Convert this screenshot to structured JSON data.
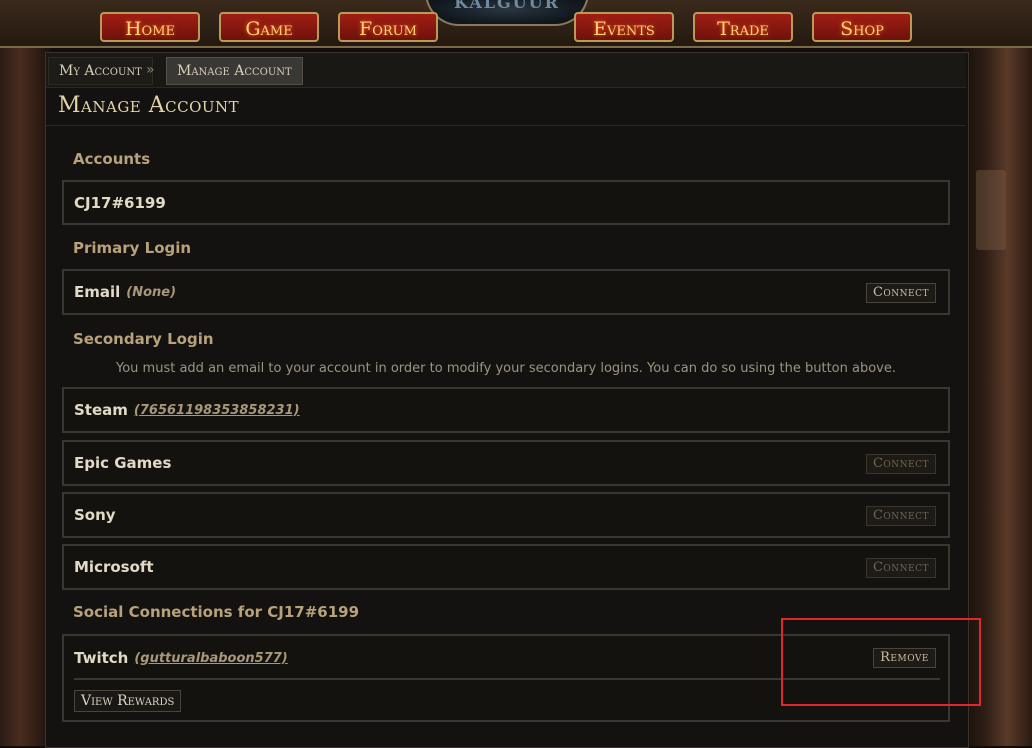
{
  "nav": {
    "logo": "KALGUUR",
    "items": [
      "Home",
      "Game",
      "Forum",
      "Events",
      "Trade",
      "Shop"
    ]
  },
  "breadcrumb": {
    "items": [
      "My Account",
      "Manage Account"
    ],
    "separator": "»"
  },
  "page_title": "Manage Account",
  "accounts": {
    "heading": "Accounts",
    "account_name": "CJ17#6199"
  },
  "primary_login": {
    "heading": "Primary Login",
    "label": "Email",
    "value": "(None)",
    "button": "Connect"
  },
  "secondary_login": {
    "heading": "Secondary Login",
    "notice": "You must add an email to your account in order to modify your secondary logins. You can do so using the button above.",
    "items": [
      {
        "label": "Steam",
        "value": "(76561198353858231)"
      },
      {
        "label": "Epic Games",
        "button": "Connect"
      },
      {
        "label": "Sony",
        "button": "Connect"
      },
      {
        "label": "Microsoft",
        "button": "Connect"
      }
    ]
  },
  "social": {
    "heading": "Social Connections for CJ17#6199",
    "label": "Twitch",
    "value": "(gutturalbaboon577)",
    "remove_button": "Remove",
    "rewards_button": "View Rewards"
  },
  "colors": {
    "nav_button": "#8c1a10",
    "nav_text": "#ffd27a",
    "highlight": "#e0282a",
    "section_heading": "#b8a27a"
  }
}
